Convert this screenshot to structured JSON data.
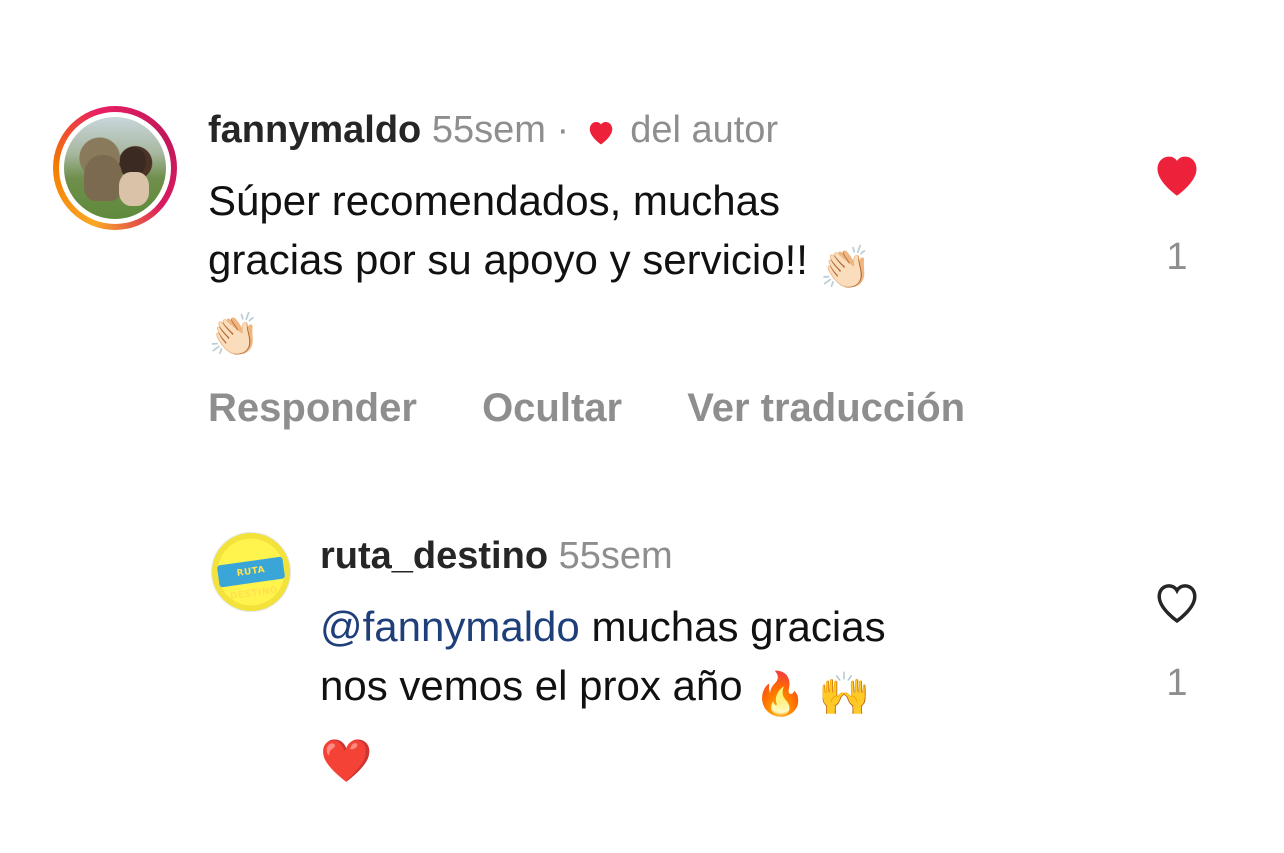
{
  "comments": [
    {
      "username": "fannymaldo",
      "time": "55sem",
      "separator": "·",
      "liked_by_author_label": "del autor",
      "text_line1": "Súper recomendados, muchas",
      "text_line2": "gracias por su apoyo y servicio!!",
      "emoji_1": "👏🏻",
      "emoji_2": "👏🏻",
      "like_count": "1",
      "liked": true,
      "actions": {
        "reply": "Responder",
        "hide": "Ocultar",
        "translate": "Ver traducción"
      }
    },
    {
      "username": "ruta_destino",
      "time": "55sem",
      "mention": "@fannymaldo",
      "text_line1": " muchas gracias",
      "text_line2": "nos vemos el prox año ",
      "emoji_fire": "🔥",
      "emoji_hands": "🙌",
      "emoji_heart": "❤️",
      "like_count": "1",
      "liked": false,
      "avatar_logo_top": "RUTA",
      "avatar_logo_bottom": "DESTINO"
    }
  ],
  "colors": {
    "like_red": "#ed213a",
    "meta_gray": "#8e8e8e",
    "mention_blue": "#1f3f7a"
  }
}
